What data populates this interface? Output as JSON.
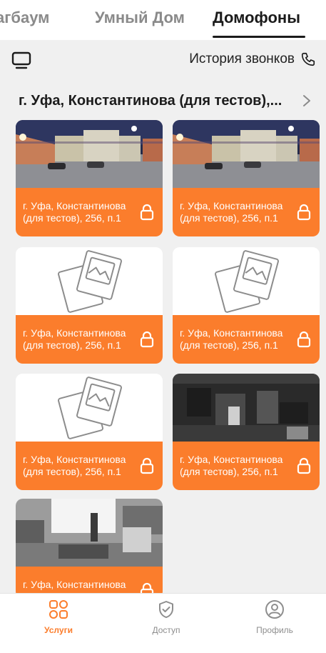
{
  "tabs": [
    {
      "label": "агбаум",
      "active": false
    },
    {
      "label": "Умный Дом",
      "active": false
    },
    {
      "label": "Домофоны",
      "active": true
    }
  ],
  "toolbar": {
    "monitor_icon": "monitor-icon",
    "history_label": "История звонков",
    "phone_icon": "phone-icon"
  },
  "address": {
    "label": "г. Уфа, Константинова (для тестов),...",
    "chevron_icon": "chevron-right-icon"
  },
  "cameras": [
    {
      "caption": "г. Уфа, Константинова (для тестов), 256, п.1",
      "preview": "night-parking-photo",
      "locked": true
    },
    {
      "caption": "г. Уфа, Константинова (для тестов), 256, п.1",
      "preview": "night-parking-photo",
      "locked": true
    },
    {
      "caption": "г. Уфа, Константинова (для тестов), 256, п.1",
      "preview": "placeholder-image-icon",
      "locked": true
    },
    {
      "caption": "г. Уфа, Константинова (для тестов), 256, п.1",
      "preview": "placeholder-image-icon",
      "locked": true
    },
    {
      "caption": "г. Уфа, Константинова (для тестов), 256, п.1",
      "preview": "placeholder-image-icon",
      "locked": true
    },
    {
      "caption": "г. Уфа, Константинова (для тестов), 256, п.1",
      "preview": "dark-room-photo",
      "locked": true
    },
    {
      "caption": "г. Уфа, Константинова",
      "preview": "bright-office-photo",
      "locked": true
    }
  ],
  "bottom_nav": [
    {
      "label": "Услуги",
      "icon": "services-grid-icon",
      "active": true
    },
    {
      "label": "Доступ",
      "icon": "shield-check-icon",
      "active": false
    },
    {
      "label": "Профиль",
      "icon": "profile-icon",
      "active": false
    }
  ],
  "colors": {
    "accent": "#fb7d2c",
    "background": "#f0f0f0",
    "text": "#1c1c1c",
    "muted": "#8e8e8e"
  }
}
